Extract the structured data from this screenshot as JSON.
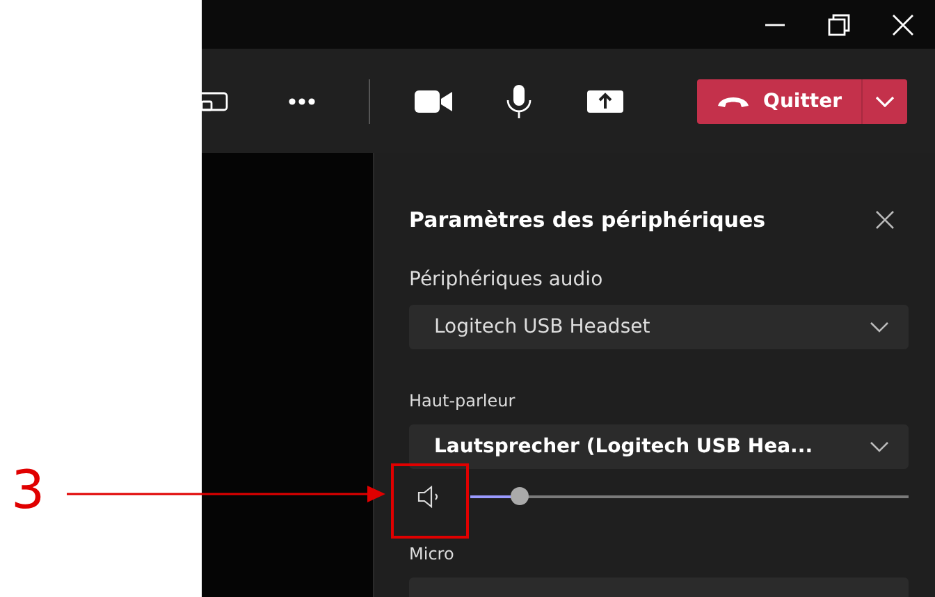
{
  "toolbar": {
    "leave_button": {
      "label": "Quitter"
    }
  },
  "panel": {
    "title": "Paramètres des périphériques",
    "audio": {
      "label": "Périphériques audio",
      "value": "Logitech USB Headset"
    },
    "speaker": {
      "label": "Haut-parleur",
      "value": "Lautsprecher (Logitech USB Hea...",
      "volume": {
        "level": 0.11
      }
    },
    "micro": {
      "label": "Micro"
    }
  },
  "annotation": {
    "label": "3"
  }
}
